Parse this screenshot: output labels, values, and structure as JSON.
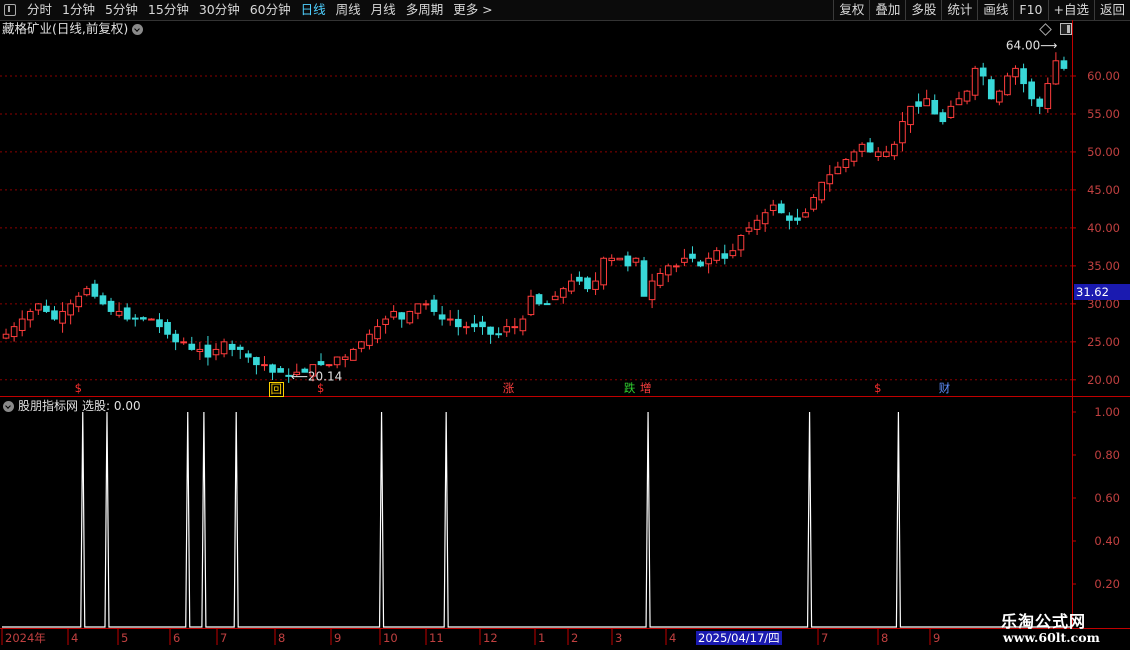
{
  "toolbar": {
    "periods": [
      "分时",
      "1分钟",
      "5分钟",
      "15分钟",
      "30分钟",
      "60分钟",
      "日线",
      "周线",
      "月线",
      "多周期",
      "更多 >"
    ],
    "active_period": "日线",
    "actions": [
      "复权",
      "叠加",
      "多股",
      "统计",
      "画线",
      "F10",
      "+自选",
      "返回"
    ]
  },
  "main_chart": {
    "title": "藏格矿业(日线,前复权)",
    "high_label": "64.00",
    "low_label": "20.14",
    "current_price": "31.62",
    "y_ticks": [
      "60.00",
      "55.00",
      "50.00",
      "45.00",
      "40.00",
      "35.00",
      "30.00",
      "25.00",
      "20.00"
    ],
    "markers": [
      {
        "text": "$",
        "color": "#ff3030"
      },
      {
        "text": "回",
        "color": "#ffd200"
      },
      {
        "text": "$",
        "color": "#ff3030"
      },
      {
        "text": "涨",
        "color": "#ff4040"
      },
      {
        "text": "跌",
        "color": "#30d030"
      },
      {
        "text": "增",
        "color": "#ff4040"
      },
      {
        "text": "$",
        "color": "#ff3030"
      },
      {
        "text": "财",
        "color": "#6090ff"
      }
    ],
    "colors": {
      "up": "#ff3c3c",
      "down": "#38d8d8",
      "grid": "#8b0000",
      "axis": "#c00000"
    }
  },
  "indicator": {
    "name": "股朋指标网",
    "select_label": "选股: 0.00",
    "y_ticks": [
      "1.00",
      "0.80",
      "0.60",
      "0.40",
      "0.20"
    ]
  },
  "x_axis": {
    "labels": [
      "2024年",
      "4",
      "5",
      "6",
      "7",
      "8",
      "9",
      "10",
      "11",
      "12",
      "1",
      "2",
      "3",
      "4",
      "7",
      "8",
      "9"
    ],
    "cursor_date": "2025/04/17/四"
  },
  "watermark": {
    "name": "乐淘公式网",
    "url": "www.60lt.com"
  },
  "chart_data": {
    "type": "candlestick",
    "title": "藏格矿业(日线,前复权)",
    "price_range": [
      18,
      65
    ],
    "close_series_approx": [
      26,
      27,
      28,
      29,
      30,
      29,
      28,
      29,
      30,
      31,
      32,
      31,
      30,
      29,
      29,
      28,
      28,
      28,
      28,
      27,
      26,
      25,
      25,
      24,
      24,
      23,
      24,
      25,
      24,
      24,
      23,
      22,
      22,
      21,
      21,
      20.5,
      21,
      21,
      22,
      22,
      22,
      23,
      23,
      24,
      25,
      26,
      27,
      28,
      29,
      28,
      29,
      30,
      30,
      29,
      28,
      28,
      27,
      27,
      27,
      27,
      26,
      26,
      27,
      27,
      28,
      31,
      30,
      30,
      31,
      32,
      33,
      33,
      32,
      33,
      36,
      36,
      36,
      35,
      36,
      31,
      33,
      34,
      35,
      35,
      36,
      36,
      35,
      36,
      37,
      36,
      37,
      39,
      40,
      41,
      42,
      43,
      42,
      41,
      41,
      42,
      44,
      46,
      47,
      48,
      49,
      50,
      51,
      50,
      50,
      50,
      51,
      54,
      56,
      56,
      57,
      55,
      54,
      56,
      57,
      58,
      61,
      60,
      57,
      58,
      60,
      61,
      59,
      57,
      56,
      59,
      62,
      61
    ],
    "indicator_signal_count": 10,
    "indicator_range": [
      0,
      1
    ]
  }
}
